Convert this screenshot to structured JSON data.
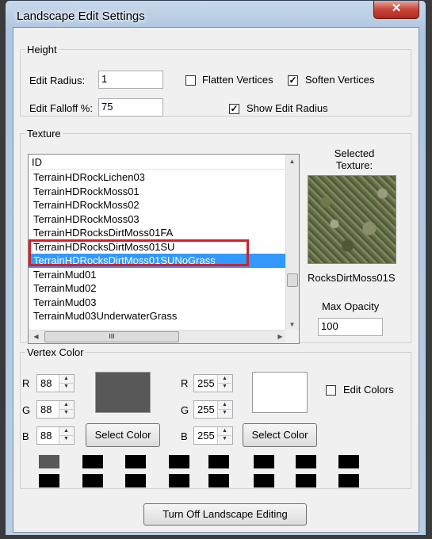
{
  "window": {
    "title": "Landscape Edit Settings",
    "close_icon": "close-icon"
  },
  "height": {
    "legend": "Height",
    "edit_radius_label": "Edit Radius:",
    "edit_radius_value": "1",
    "edit_falloff_label": "Edit Falloff %:",
    "edit_falloff_value": "75",
    "flatten_vertices_label": "Flatten Vertices",
    "flatten_vertices_checked": false,
    "soften_vertices_label": "Soften Vertices",
    "soften_vertices_checked": true,
    "show_edit_radius_label": "Show Edit Radius",
    "show_edit_radius_checked": true
  },
  "texture": {
    "legend": "Texture",
    "list_header": "ID",
    "rows": [
      "TerrainHDRockLichen03",
      "TerrainHDRockMoss01",
      "TerrainHDRockMoss02",
      "TerrainHDRockMoss03",
      "TerrainHDRocksDirtMoss01FA",
      "TerrainHDRocksDirtMoss01SU",
      "TerrainHDRocksDirtMoss01SUNoGrass",
      "TerrainMud01",
      "TerrainMud02",
      "TerrainMud03",
      "TerrainMud03UnderwaterGrass"
    ],
    "selected_index": 6,
    "selected_texture_label": "Selected Texture:",
    "selected_texture_name": "RocksDirtMoss01S",
    "max_opacity_label": "Max Opacity",
    "max_opacity_value": "100",
    "hscroll_grip": "III"
  },
  "vertex_color": {
    "legend": "Vertex Color",
    "left": {
      "r": "88",
      "g": "88",
      "b": "88",
      "swatch_color": "#585858"
    },
    "right": {
      "r": "255",
      "g": "255",
      "b": "255",
      "swatch_color": "#ffffff"
    },
    "r_label": "R",
    "g_label": "G",
    "b_label": "B",
    "select_color_label": "Select Color",
    "edit_colors_label": "Edit Colors",
    "edit_colors_checked": false,
    "palette_colors": [
      "#585858",
      "#000000",
      "#000000",
      "#000000",
      "#000000",
      "#000000",
      "#000000",
      "#000000",
      "#000000",
      "#000000",
      "#000000",
      "#000000",
      "#000000",
      "#000000",
      "#000000",
      "#000000"
    ]
  },
  "footer": {
    "turn_off_label": "Turn Off Landscape Editing"
  },
  "colors": {
    "selection": "#3399ff",
    "highlight_outline": "#d4202a"
  }
}
